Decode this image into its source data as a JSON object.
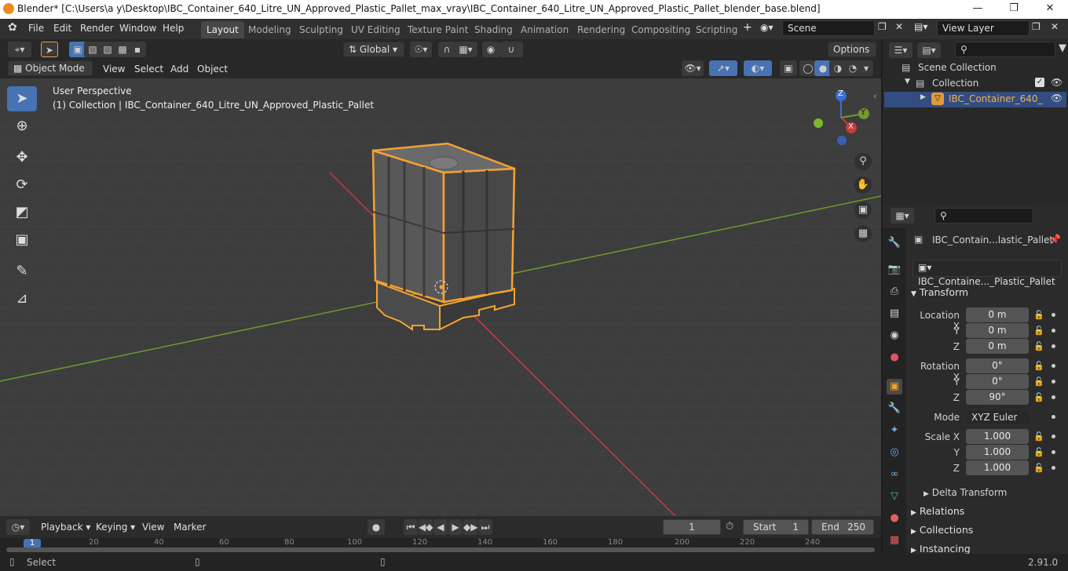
{
  "window": {
    "title": "Blender* [C:\\Users\\a y\\Desktop\\IBC_Container_640_Litre_UN_Approved_Plastic_Pallet_max_vray\\IBC_Container_640_Litre_UN_Approved_Plastic_Pallet_blender_base.blend]"
  },
  "menus": [
    "File",
    "Edit",
    "Render",
    "Window",
    "Help"
  ],
  "workspaces": [
    "Layout",
    "Modeling",
    "Sculpting",
    "UV Editing",
    "Texture Paint",
    "Shading",
    "Animation",
    "Rendering",
    "Compositing",
    "Scripting"
  ],
  "scene": "Scene",
  "view_layer": "View Layer",
  "viewport_header": {
    "transform_orientation": "Global",
    "options_label": "Options",
    "mode": "Object Mode",
    "menus": [
      "View",
      "Select",
      "Add",
      "Object"
    ]
  },
  "viewport": {
    "perspective": "User Perspective",
    "collection_info": "(1) Collection | IBC_Container_640_Litre_UN_Approved_Plastic_Pallet",
    "gizmo": {
      "z": "Z",
      "y": "Y",
      "x": "X"
    }
  },
  "outliner": {
    "scene_collection": "Scene Collection",
    "collection": "Collection",
    "object": "IBC_Container_640_"
  },
  "properties": {
    "object_name": "IBC_Contain...lastic_Pallet",
    "data_name": "IBC_Containe..._Plastic_Pallet",
    "transform_title": "Transform",
    "location": {
      "label": "Location X",
      "x": "0 m",
      "y": "0 m",
      "z": "0 m"
    },
    "rotation": {
      "label": "Rotation X",
      "x": "0°",
      "y": "0°",
      "z": "90°"
    },
    "mode_label": "Mode",
    "mode_value": "XYZ Euler",
    "scale": {
      "label": "Scale X",
      "x": "1.000",
      "y": "1.000",
      "z": "1.000"
    },
    "axis_y": "Y",
    "axis_z": "Z",
    "delta_transform": "Delta Transform",
    "relations": "Relations",
    "collections": "Collections",
    "instancing": "Instancing"
  },
  "timeline": {
    "menus": [
      "Playback",
      "Keying",
      "View",
      "Marker"
    ],
    "current_frame": "1",
    "start_label": "Start",
    "start_value": "1",
    "end_label": "End",
    "end_value": "250",
    "ruler": [
      "1",
      "20",
      "40",
      "60",
      "80",
      "100",
      "120",
      "140",
      "160",
      "180",
      "200",
      "220",
      "240"
    ]
  },
  "status": {
    "select": "Select",
    "version": "2.91.0"
  },
  "colors": {
    "accent": "#4772b3",
    "selection_outline": "#f5a232",
    "x_axis": "#c93b3b",
    "y_axis": "#6e9a2e"
  }
}
